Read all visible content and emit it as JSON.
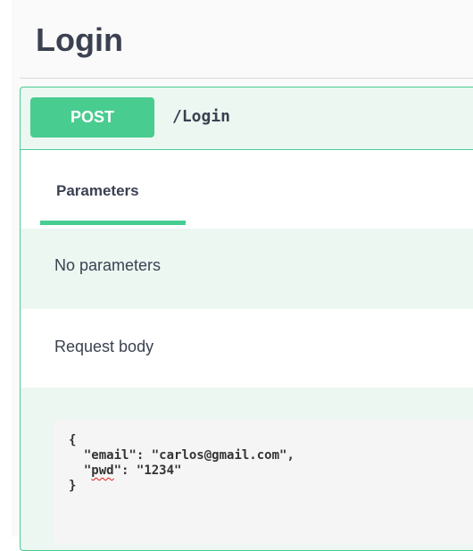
{
  "tag": {
    "title": "Login"
  },
  "operation": {
    "method": "POST",
    "path": "/Login"
  },
  "tabs": [
    {
      "label": "Parameters"
    }
  ],
  "parameters": {
    "empty_text": "No parameters"
  },
  "request_body": {
    "label": "Request body",
    "lines": {
      "open": "{",
      "email_key": "\"email\"",
      "email_sep": ": ",
      "email_value": "\"carlos@gmail.com\",",
      "pwd_quote_open": "\"",
      "pwd_key": "pwd",
      "pwd_quote_close": "\"",
      "pwd_sep": ": ",
      "pwd_value": "\"1234\"",
      "close": "}"
    }
  },
  "colors": {
    "accent": "#49cc90",
    "accent_bg": "#ecf7f2",
    "text": "#3b4151",
    "spellcheck": "#e01b1b"
  }
}
